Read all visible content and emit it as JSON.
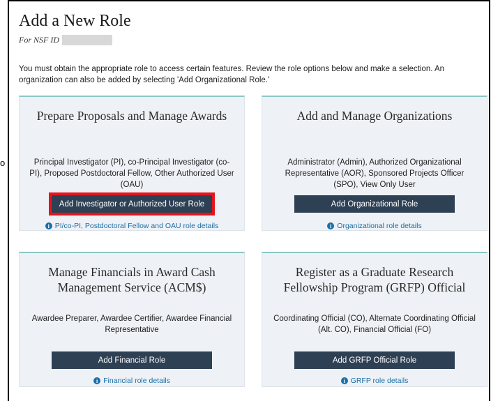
{
  "page": {
    "title": "Add a New Role",
    "subtitle_prefix": "For NSF ID",
    "intro": "You must obtain the appropriate role to access certain features. Review the role options below and make a selection. An organization can also be added by selecting 'Add Organizational Role.'",
    "stray_char": "o"
  },
  "cards": [
    {
      "title": "Prepare Proposals and Manage Awards",
      "description": "Principal Investigator (PI), co-Principal Investigator (co-PI), Proposed Postdoctoral Fellow, Other Authorized User (OAU)",
      "button": "Add Investigator or Authorized User Role",
      "link": "PI/co-PI, Postdoctoral Fellow and OAU role details"
    },
    {
      "title": "Add and Manage Organizations",
      "description": "Administrator (Admin), Authorized Organizational Representative (AOR), Sponsored Projects Officer (SPO), View Only User",
      "button": "Add Organizational Role",
      "link": "Organizational role details"
    },
    {
      "title": "Manage Financials in Award Cash Management Service (ACM$)",
      "description": "Awardee Preparer, Awardee Certifier, Awardee Financial Representative",
      "button": "Add Financial Role",
      "link": "Financial role details"
    },
    {
      "title": "Register as a Graduate Research Fellowship Program (GRFP) Official",
      "description": "Coordinating Official (CO), Alternate Coordinating Official (Alt. CO), Financial Official (FO)",
      "button": "Add GRFP Official Role",
      "link": "GRFP role details"
    }
  ],
  "icons": {
    "info": "info-circle-icon"
  },
  "colors": {
    "button_bg": "#2e4054",
    "card_bg": "#eef1f5",
    "card_accent": "#8bc6c3",
    "link": "#1c6fa8",
    "highlight": "#e3151d"
  }
}
